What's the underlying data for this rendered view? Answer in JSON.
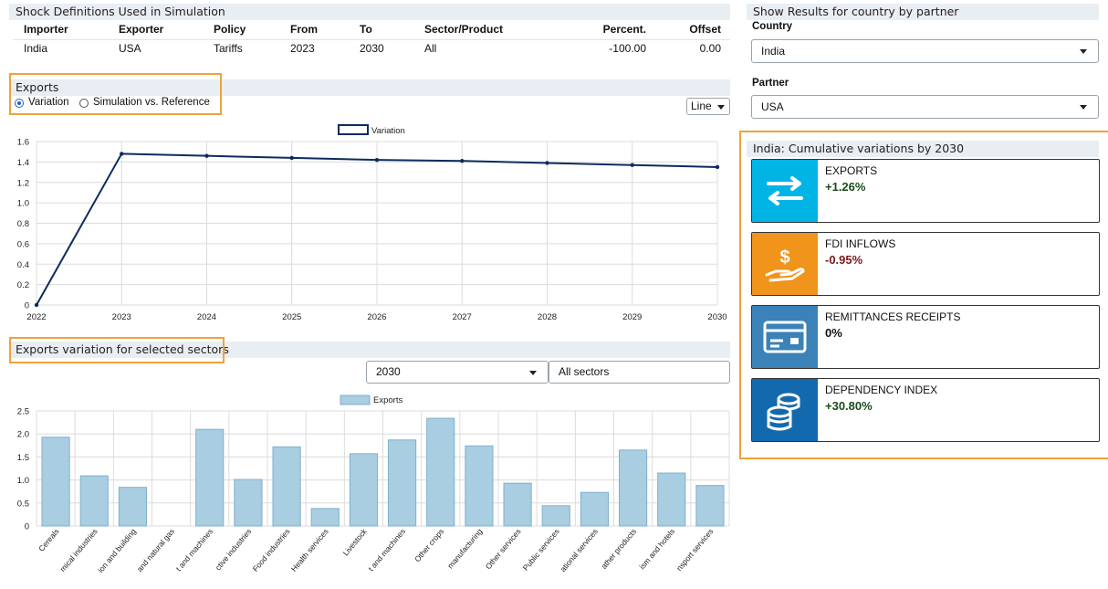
{
  "shock": {
    "title": "Shock Definitions Used in Simulation",
    "headers": [
      "Importer",
      "Exporter",
      "Policy",
      "From",
      "To",
      "Sector/Product",
      "Percent.",
      "Offset"
    ],
    "row": [
      "India",
      "USA",
      "Tariffs",
      "2023",
      "2030",
      "All",
      "-100.00",
      "0.00"
    ]
  },
  "exports": {
    "title": "Exports",
    "radio_variation": "Variation",
    "radio_simulation": "Simulation vs. Reference",
    "chart_type": "Line",
    "legend": "Variation"
  },
  "sectors": {
    "title": "Exports variation for selected sectors",
    "year": "2030",
    "filter": "All sectors",
    "legend": "Exports"
  },
  "right": {
    "title": "Show Results for country by partner",
    "country_label": "Country",
    "country_value": "India",
    "partner_label": "Partner",
    "partner_value": "USA",
    "summary_title": "India: Cumulative variations by 2030",
    "cards": [
      {
        "title": "EXPORTS",
        "value": "+1.26%",
        "color": "#00b4e6",
        "icon": "exchange-arrows-icon"
      },
      {
        "title": "FDI INFLOWS",
        "value": "-0.95%",
        "color": "#f0941c",
        "icon": "hand-dollar-icon"
      },
      {
        "title": "REMITTANCES RECEIPTS",
        "value": "0%",
        "color": "#3a82b8",
        "icon": "credit-card-icon"
      },
      {
        "title": "DEPENDENCY INDEX",
        "value": "+30.80%",
        "color": "#1369ad",
        "icon": "coin-stack-icon"
      }
    ]
  },
  "chart_data": [
    {
      "type": "line",
      "x": [
        "2022",
        "2023",
        "2024",
        "2025",
        "2026",
        "2027",
        "2028",
        "2029",
        "2030"
      ],
      "series": [
        {
          "name": "Variation",
          "values": [
            0,
            1.48,
            1.46,
            1.44,
            1.42,
            1.41,
            1.39,
            1.37,
            1.35
          ]
        }
      ],
      "ylim": [
        0,
        1.6
      ],
      "yticks": [
        "0",
        "0.2",
        "0.4",
        "0.6",
        "0.8",
        "1.0",
        "1.2",
        "1.4",
        "1.6"
      ],
      "color": "#0d2b5e",
      "grid": true,
      "legend": "top-center"
    },
    {
      "type": "bar",
      "categories": [
        "Cereals",
        "Chemical industries",
        "Construction and building",
        "Crude oil and natural gas",
        "Electrical equipment and machines",
        "Extractive industries",
        "Food industries",
        "Health services",
        "Livestock",
        "Metals and machines",
        "Other crops",
        "Other manufacturing",
        "Other services",
        "Public services",
        "Recreational services",
        "Textiles and leather products",
        "Tourism and hotels",
        "Transport services"
      ],
      "tick_labels": [
        "Cereals",
        "mical industries",
        "ion and building",
        "and natural gas",
        "t and machines",
        "ctive industries",
        "Food industries",
        "Health services",
        "Livestock",
        "t and machines",
        "Other crops",
        "manufacturing",
        "Other services",
        "Public services",
        "ational services",
        "ather products",
        "ism and hotels",
        "nsport services"
      ],
      "series": [
        {
          "name": "Exports",
          "values": [
            1.93,
            1.09,
            0.84,
            0.0,
            2.1,
            1.01,
            1.72,
            0.38,
            1.57,
            1.87,
            2.34,
            1.74,
            0.93,
            0.44,
            0.73,
            1.65,
            1.15,
            0.88
          ]
        }
      ],
      "ylim": [
        0,
        2.5
      ],
      "yticks": [
        "0",
        "0.5",
        "1.0",
        "1.5",
        "2.0",
        "2.5"
      ],
      "color": "#a9cde1",
      "grid": true,
      "legend": "top-center"
    }
  ]
}
